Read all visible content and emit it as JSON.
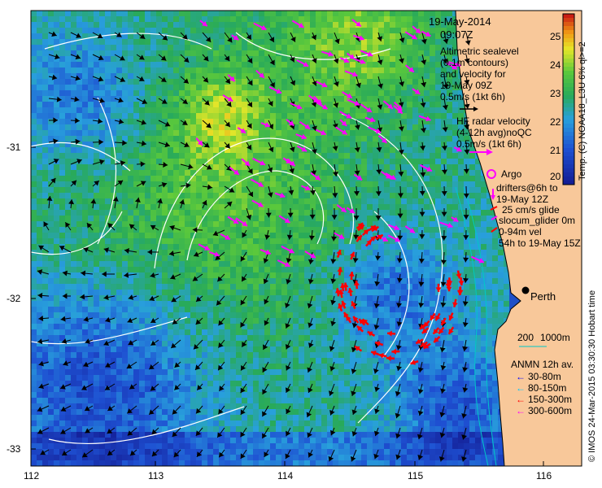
{
  "header": {
    "date": "19-May-2014",
    "time": "09:07Z"
  },
  "legend": {
    "altimetry_lines": [
      "Altimetric sealevel",
      "(0.1m contours)",
      "and velocity for",
      "19-May 09Z",
      "0.5m/s (1kt 6h)"
    ],
    "hf_radar_lines": [
      "HF radar velocity",
      "(4-12h avg)noQC",
      "0.5m/s (1kt 6h)"
    ],
    "argo": "Argo",
    "drifters_lines": [
      "drifters@6h to",
      "19-May 12Z"
    ],
    "glide": "25 cm/s glide",
    "glider_lines": [
      "slocum_glider 0m",
      "0-94m vel",
      "54h to 19-May 15Z"
    ],
    "bathy": [
      "200",
      "1000m"
    ],
    "anmn_title": "ANMN 12h av.",
    "anmn_items": [
      {
        "label": "30-80m",
        "color": "#0000ff"
      },
      {
        "label": "80-150m",
        "color": "#00c8ff"
      },
      {
        "label": "150-300m",
        "color": "#ff0000"
      },
      {
        "label": "300-600m",
        "color": "#ff00ff"
      }
    ]
  },
  "place": {
    "name": "Perth"
  },
  "colorbar": {
    "label": "Temp. (C) NOAA18_L3U 6% ql>=2",
    "ticks": [
      "25",
      "24",
      "23",
      "22",
      "21",
      "20"
    ],
    "vmin": 19.6,
    "vmax": 25.6
  },
  "axes": {
    "x_ticks": [
      "112",
      "113",
      "114",
      "115",
      "116"
    ],
    "y_ticks": [
      "-31",
      "-32",
      "-33"
    ]
  },
  "credit": "© IMOS 24-Mar-2015 03:30:30 Hobart time",
  "colors": {
    "land": "#f8c89a",
    "altimetry_arrow": "#000000",
    "hf_radar_arrow": "#ff00ff",
    "glider_arrow": "#ff0000",
    "contour": "#ffffff",
    "bathy_contour": "#00c8c8"
  }
}
